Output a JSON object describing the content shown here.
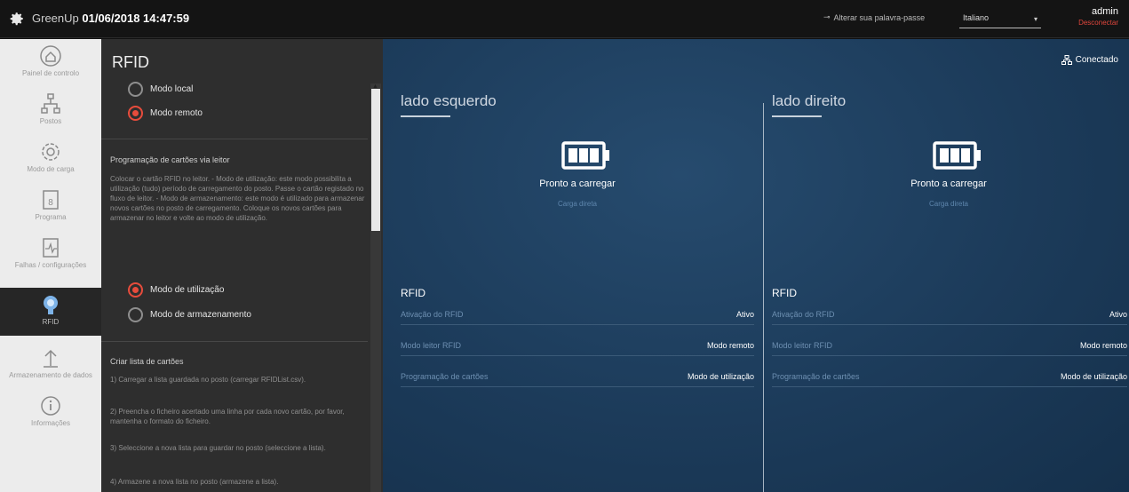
{
  "topbar": {
    "app_name": "GreenUp",
    "datetime": "01/06/2018 14:47:59",
    "alert": "Alterar sua palavra-passe",
    "language": "Italiano",
    "user": "admin",
    "logout": "Desconectar"
  },
  "nav": {
    "items": [
      {
        "label": "Painel de controlo",
        "icon": "home-icon"
      },
      {
        "label": "Postos",
        "icon": "network-icon"
      },
      {
        "label": "Modo de carga",
        "icon": "gear-icon"
      },
      {
        "label": "Programa",
        "icon": "calendar-icon"
      },
      {
        "label": "Falhas / configurações",
        "icon": "chart-icon"
      },
      {
        "label": "RFID",
        "icon": "rfid-icon"
      },
      {
        "label": "Armazenamento de dados",
        "icon": "upload-icon"
      },
      {
        "label": "Informações",
        "icon": "info-icon"
      }
    ],
    "active": "RFID"
  },
  "panel": {
    "title": "RFID",
    "mode_local": "Modo local",
    "mode_remote": "Modo remoto",
    "prog_title": "Programação de cartões via leitor",
    "prog_text": "Colocar o cartão RFID no leitor. - Modo de utilização: este modo possibilita a utilização (tudo) período de carregamento do posto. Passe o cartão registado no fluxo de leitor. - Modo de armazenamento: este modo é utilizado para armazenar novos cartões no posto de carregamento. Coloque os novos cartões para armazenar no leitor e volte ao modo de utilização.",
    "mode_use": "Modo de utilização",
    "mode_store": "Modo de armazenamento",
    "list_title": "Criar lista de cartões",
    "step1": "1) Carregar a lista guardada no posto (carregar RFIDList.csv).",
    "step2": "2) Preencha o ficheiro acertado uma linha por cada novo cartão, por favor, mantenha o formato do ficheiro.",
    "step3": "3) Seleccione a nova lista para guardar no posto (seleccione a lista).",
    "step4": "4) Armazene a nova lista no posto (armazene a lista)."
  },
  "main": {
    "connected": "Conectado",
    "left": {
      "title": "lado esquerdo",
      "status": "Pronto a carregar",
      "sub": "Carga direta",
      "rfid_title": "RFID",
      "rows": [
        {
          "k": "Ativação do RFID",
          "v": "Ativo"
        },
        {
          "k": "Modo leitor RFID",
          "v": "Modo remoto"
        },
        {
          "k": "Programação de cartões",
          "v": "Modo de utilização"
        }
      ]
    },
    "right": {
      "title": "lado direito",
      "status": "Pronto a carregar",
      "sub": "Carga direta",
      "rfid_title": "RFID",
      "rows": [
        {
          "k": "Ativação do RFID",
          "v": "Ativo"
        },
        {
          "k": "Modo leitor RFID",
          "v": "Modo remoto"
        },
        {
          "k": "Programação de cartões",
          "v": "Modo de utilização"
        }
      ]
    }
  },
  "colors": {
    "accent": "#e74c3c",
    "main_bg": "#1c3b5a",
    "nav_bg": "#ececec",
    "panel_bg": "#2e2e2e"
  }
}
